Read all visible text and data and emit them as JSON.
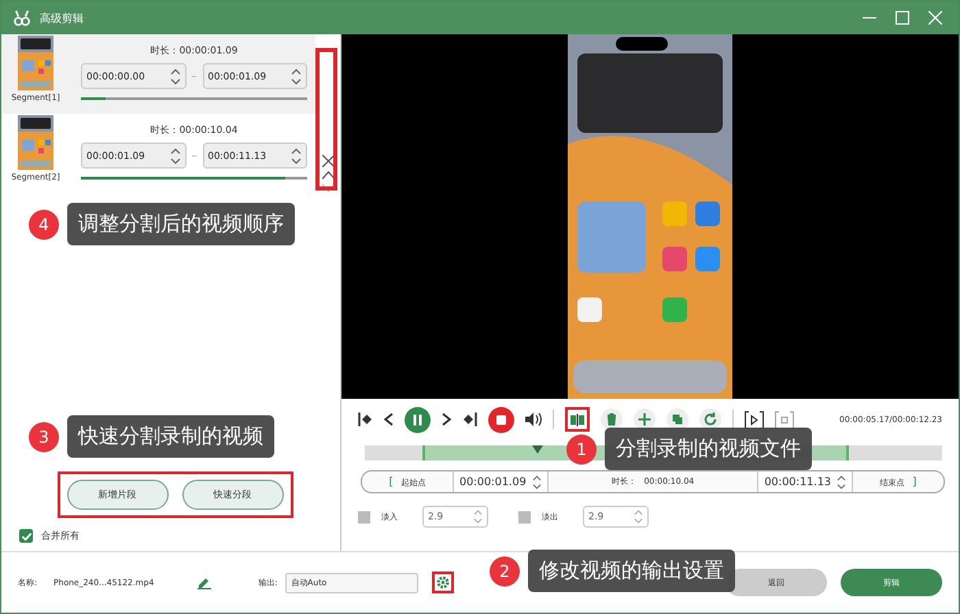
{
  "window": {
    "title": "高级剪辑"
  },
  "segments": [
    {
      "label": "Segment[1]",
      "duration_label": "时长：",
      "duration": "00:00:01.09",
      "start": "00:00:00.00",
      "separator": "–",
      "end": "00:00:01.09",
      "level": 0.11,
      "selected": true
    },
    {
      "label": "Segment[2]",
      "duration_label": "时长：",
      "duration": "00:00:10.04",
      "start": "00:00:01.09",
      "separator": "–",
      "end": "00:00:11.13",
      "level": 0.9,
      "selected": false
    }
  ],
  "left_buttons": [
    "新增片段",
    "快速分段"
  ],
  "merge_all": {
    "label": "合并所有",
    "checked": true
  },
  "player": {
    "time": "00:00:05.17/00:00:12.23",
    "timeline": {
      "level": 0.3
    }
  },
  "range": {
    "start_bracket": "[",
    "start_button": "起始点",
    "start": "00:00:01.09",
    "duration_label": "时长：",
    "duration": "00:00:10.04",
    "end": "00:00:11.13",
    "end_button": "结束点",
    "end_bracket": "]"
  },
  "fades": [
    {
      "label": "淡入",
      "checked": false,
      "value": "2.9"
    },
    {
      "label": "淡出",
      "checked": false,
      "value": "2.9"
    }
  ],
  "footer": {
    "name_label": "名称:",
    "file_name": "Phone_240...45122.mp4",
    "output_label": "输出:",
    "output": "自动Auto",
    "buttons": [
      "返回",
      "剪辑"
    ]
  },
  "callouts": [
    {
      "number": "4",
      "text": "调整分割后的视频顺序"
    },
    {
      "number": "3",
      "text": "快速分割录制的视频"
    },
    {
      "number": "1",
      "text": "分割录制的视频文件"
    },
    {
      "number": "2",
      "text": "修改视频的输出设置"
    }
  ]
}
